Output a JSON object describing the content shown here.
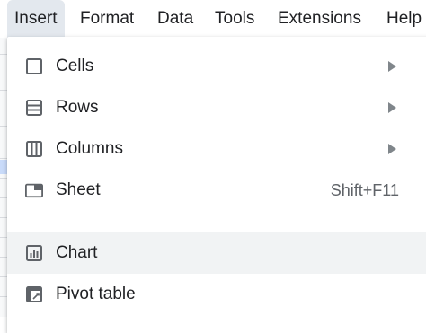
{
  "menubar": {
    "items": [
      {
        "label": "Insert"
      },
      {
        "label": "Format"
      },
      {
        "label": "Data"
      },
      {
        "label": "Tools"
      },
      {
        "label": "Extensions"
      },
      {
        "label": "Help"
      }
    ]
  },
  "insert_menu": {
    "items": [
      {
        "label": "Cells",
        "icon": "cells-icon",
        "submenu": true
      },
      {
        "label": "Rows",
        "icon": "rows-icon",
        "submenu": true
      },
      {
        "label": "Columns",
        "icon": "columns-icon",
        "submenu": true
      },
      {
        "label": "Sheet",
        "icon": "sheet-icon",
        "shortcut": "Shift+F11"
      },
      {
        "label": "Chart",
        "icon": "chart-icon",
        "highlighted": true
      },
      {
        "label": "Pivot table",
        "icon": "pivot-table-icon"
      }
    ]
  },
  "colors": {
    "active_menu_bg": "#e3e8ee",
    "hover_bg": "#f1f3f4",
    "icon": "#5f6368",
    "separator": "#dadce0"
  }
}
